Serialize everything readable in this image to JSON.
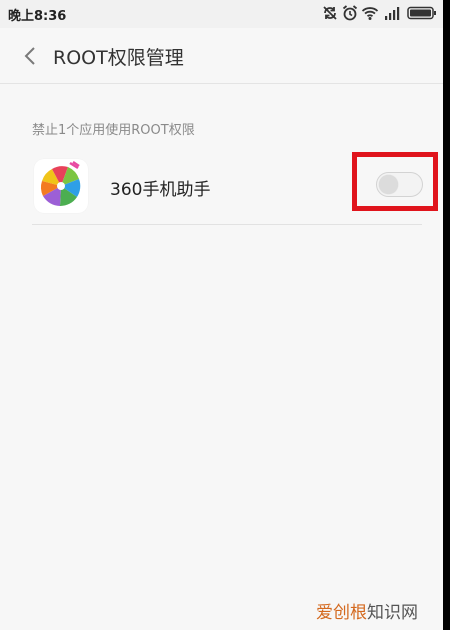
{
  "status_bar": {
    "time": "晚上8:36",
    "icons": [
      "sync-off-icon",
      "alarm-icon",
      "wifi-icon",
      "signal-icon",
      "battery-icon"
    ]
  },
  "header": {
    "back_icon": "chevron-left-icon",
    "title": "ROOT权限管理"
  },
  "section": {
    "label": "禁止1个应用使用ROOT权限"
  },
  "apps": [
    {
      "name": "360手机助手",
      "icon": "360-assistant-app-icon",
      "root_enabled": false
    }
  ],
  "colors": {
    "highlight": "#e0141c",
    "background": "#f7f7f7"
  },
  "watermark": {
    "brand": "爱创根",
    "suffix": "知识网"
  }
}
